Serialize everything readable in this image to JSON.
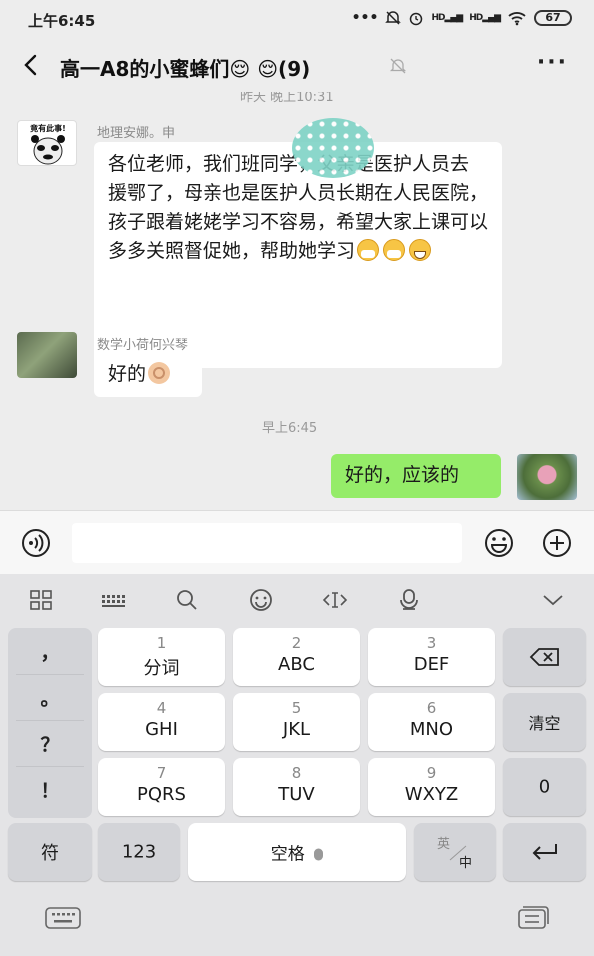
{
  "status_bar": {
    "time": "上午6:45",
    "battery": "67"
  },
  "header": {
    "title": "高一A8的小蜜蜂们😌 😌(9)",
    "more": "···"
  },
  "chat": {
    "timestamp_top": "昨天 晚上10:31",
    "timestamp_2": "早上6:45",
    "messages": [
      {
        "sender": "地理安娜。申",
        "text": "各位老师，我们班",
        "text_cont": "同学，父亲是医护人员去援鄂了，母亲也是医护人员长期在人民医院，孩子跟着姥姥学习不容易，希望大家上课可以多多关照督促她，帮助她学习"
      },
      {
        "sender": "数学小荷何兴琴",
        "text": "好的"
      },
      {
        "sender": "",
        "text": "好的，应该的"
      }
    ],
    "sticker_avatar_text": "竟有此事!"
  },
  "input": {
    "value": "",
    "placeholder": ""
  },
  "keyboard": {
    "punctuation": [
      "，",
      "。",
      "？",
      "！"
    ],
    "keys": [
      {
        "num": "1",
        "label": "分词"
      },
      {
        "num": "2",
        "label": "ABC"
      },
      {
        "num": "3",
        "label": "DEF"
      },
      {
        "num": "4",
        "label": "GHI"
      },
      {
        "num": "5",
        "label": "JKL"
      },
      {
        "num": "6",
        "label": "MNO"
      },
      {
        "num": "7",
        "label": "PQRS"
      },
      {
        "num": "8",
        "label": "TUV"
      },
      {
        "num": "9",
        "label": "WXYZ"
      }
    ],
    "clear": "清空",
    "zero": "0",
    "symbol": "符",
    "numbers": "123",
    "space": "空格",
    "lang_top": "英",
    "lang_bottom": "中"
  }
}
